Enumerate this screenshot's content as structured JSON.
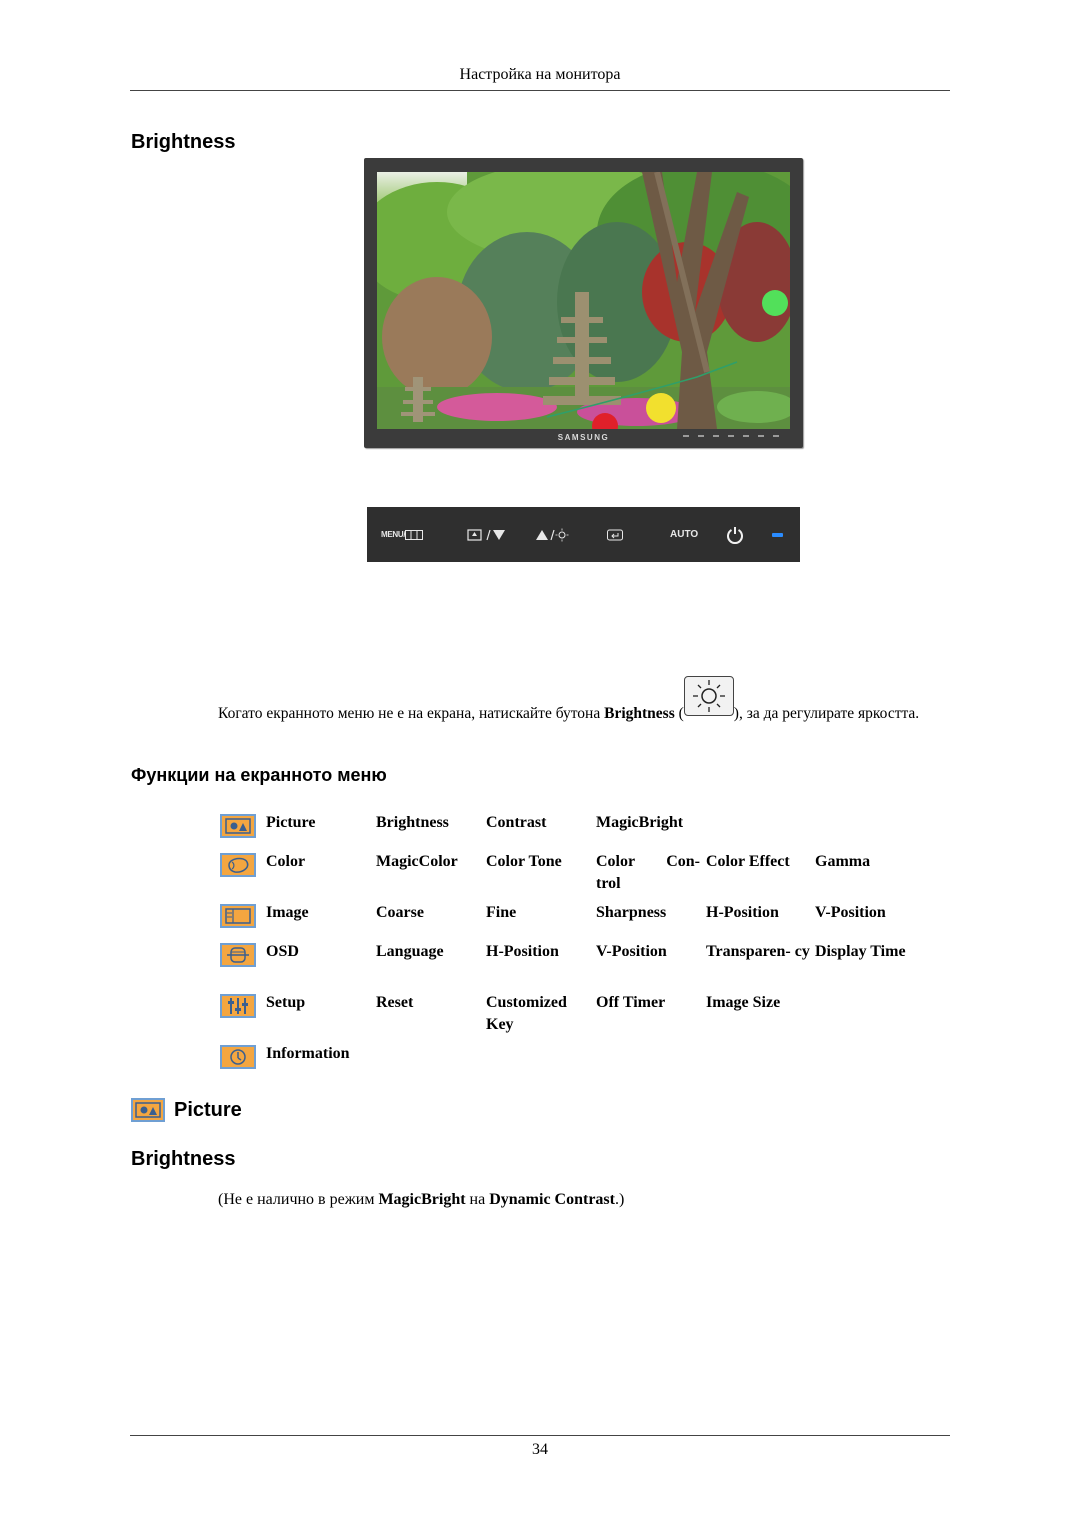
{
  "header": {
    "running_title": "Настройка на монитора"
  },
  "section_brightness": {
    "heading": "Brightness",
    "monitor": {
      "brand": "SAMSUNG",
      "image_description": "garden with stone pagodas, trees and lanterns"
    },
    "control_strip": {
      "menu_label": "MENU/",
      "source_icon": "source-down-icon",
      "up_icon": "up-brightness-icon",
      "enter_icon": "enter-icon",
      "auto_label": "AUTO",
      "power_icon": "power-icon",
      "led_color": "#2a8cff"
    },
    "instruction": {
      "part1": "Когато екранното меню не е на екрана, натискайте бутона ",
      "bold": "Brightness",
      "part2": " (",
      "icon": "sun-icon",
      "part3": "), за да регулирате яркостта."
    }
  },
  "osd_functions": {
    "heading": "Функции на екранното меню",
    "rows": [
      {
        "icon": "picture-icon",
        "cells": [
          "Picture",
          "Brightness",
          "Contrast",
          "MagicBright",
          "",
          ""
        ]
      },
      {
        "icon": "color-icon",
        "cells": [
          "Color",
          "MagicColor",
          "Color Tone",
          "Color Con- trol",
          "Color Effect",
          "Gamma"
        ]
      },
      {
        "icon": "image-icon",
        "cells": [
          "Image",
          "Coarse",
          "Fine",
          "Sharpness",
          "H-Position",
          "V-Position"
        ]
      },
      {
        "icon": "osd-icon",
        "cells": [
          "OSD",
          "Language",
          "H-Position",
          "V-Position",
          "Transparen- cy",
          "Display Time"
        ]
      },
      {
        "icon": "setup-icon",
        "cells": [
          "Setup",
          "Reset",
          "Customized Key",
          "Off Timer",
          "Image Size",
          ""
        ]
      },
      {
        "icon": "information-icon",
        "cells": [
          "Information",
          "",
          "",
          "",
          "",
          ""
        ]
      }
    ]
  },
  "picture_section": {
    "heading": "Picture",
    "subheading": "Brightness",
    "note": {
      "part1": "(Не е налично в режим ",
      "bold1": "MagicBright",
      "part2": " на ",
      "bold2": "Dynamic Contrast",
      "part3": ".)"
    }
  },
  "footer": {
    "page_number": "34"
  },
  "colors": {
    "icon_fill": "#f4a640",
    "icon_border": "#6f9fd3",
    "icon_glyph": "#3a5f8f"
  }
}
